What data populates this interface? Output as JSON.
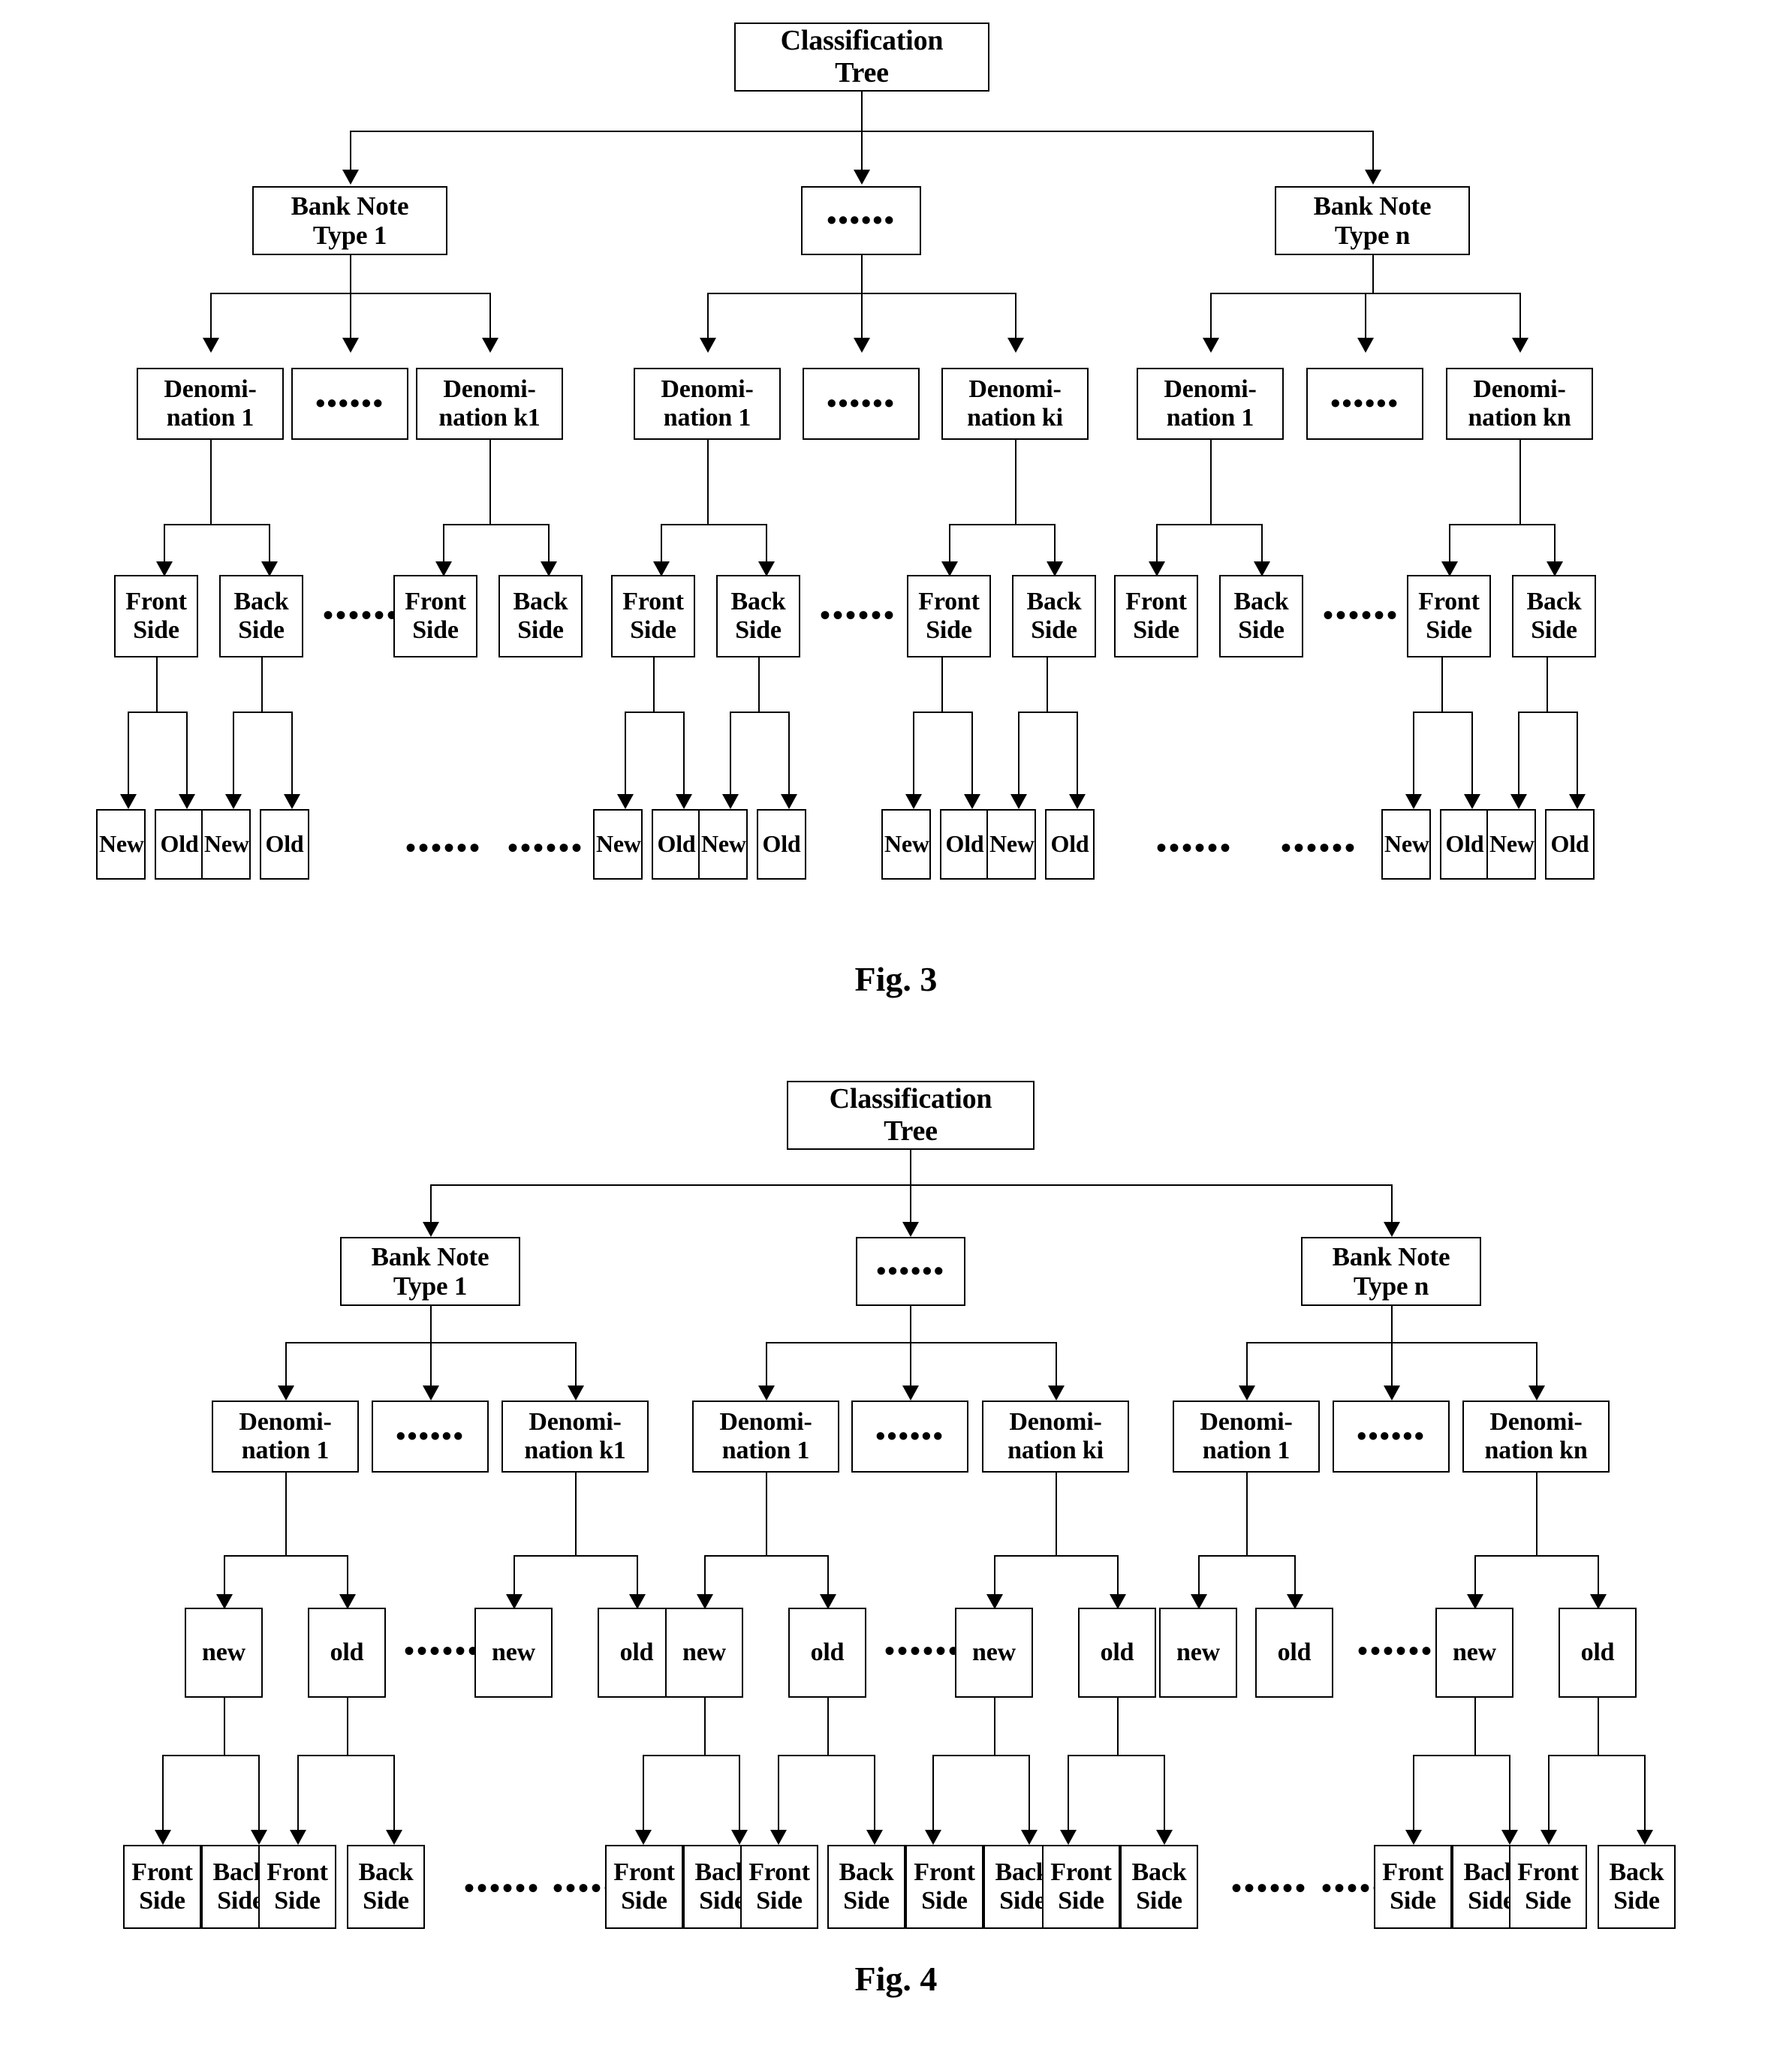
{
  "page": {
    "background": "#ffffff",
    "ink": "#000000"
  },
  "figures": [
    {
      "id": "fig3",
      "caption": "Fig. 3",
      "root": {
        "line1": "Classification",
        "line2": "Tree"
      },
      "level_types": [
        {
          "line1": "Bank Note",
          "line2": "Type 1"
        },
        {
          "dots": "••••••"
        },
        {
          "line1": "Bank Note",
          "line2": "Type n"
        }
      ],
      "level_denominations": [
        {
          "line1": "Denomi-",
          "line2": "nation 1"
        },
        {
          "dots": "••••••"
        },
        {
          "line1": "Denomi-",
          "line2": "nation k1"
        },
        {
          "line1": "Denomi-",
          "line2": "nation 1"
        },
        {
          "dots": "••••••"
        },
        {
          "line1": "Denomi-",
          "line2": "nation ki"
        },
        {
          "line1": "Denomi-",
          "line2": "nation 1"
        },
        {
          "dots": "••••••"
        },
        {
          "line1": "Denomi-",
          "line2": "nation kn"
        }
      ],
      "level_sides": [
        {
          "line1": "Front",
          "line2": "Side"
        },
        {
          "line1": "Back",
          "line2": "Side"
        },
        {
          "line1": "Front",
          "line2": "Side"
        },
        {
          "line1": "Back",
          "line2": "Side"
        },
        {
          "line1": "Front",
          "line2": "Side"
        },
        {
          "line1": "Back",
          "line2": "Side"
        },
        {
          "line1": "Front",
          "line2": "Side"
        },
        {
          "line1": "Back",
          "line2": "Side"
        },
        {
          "line1": "Front",
          "line2": "Side"
        },
        {
          "line1": "Back",
          "line2": "Side"
        },
        {
          "line1": "Front",
          "line2": "Side"
        },
        {
          "line1": "Back",
          "line2": "Side"
        }
      ],
      "level_sides_dots": [
        "••••••",
        "••••••",
        "••••••"
      ],
      "level_condition": [
        {
          "label": "New"
        },
        {
          "label": "Old"
        },
        {
          "label": "New"
        },
        {
          "label": "Old"
        },
        {
          "label": "New"
        },
        {
          "label": "Old"
        },
        {
          "label": "New"
        },
        {
          "label": "Old"
        },
        {
          "label": "New"
        },
        {
          "label": "Old"
        },
        {
          "label": "New"
        },
        {
          "label": "Old"
        },
        {
          "label": "New"
        },
        {
          "label": "Old"
        },
        {
          "label": "New"
        },
        {
          "label": "Old"
        }
      ],
      "level_condition_dots": [
        "••••••",
        "••••••",
        "••••••",
        "••••••"
      ]
    },
    {
      "id": "fig4",
      "caption": "Fig. 4",
      "root": {
        "line1": "Classification",
        "line2": "Tree"
      },
      "level_types": [
        {
          "line1": "Bank Note",
          "line2": "Type 1"
        },
        {
          "dots": "••••••"
        },
        {
          "line1": "Bank Note",
          "line2": "Type n"
        }
      ],
      "level_denominations": [
        {
          "line1": "Denomi-",
          "line2": "nation 1"
        },
        {
          "dots": "••••••"
        },
        {
          "line1": "Denomi-",
          "line2": "nation k1"
        },
        {
          "line1": "Denomi-",
          "line2": "nation 1"
        },
        {
          "dots": "••••••"
        },
        {
          "line1": "Denomi-",
          "line2": "nation ki"
        },
        {
          "line1": "Denomi-",
          "line2": "nation 1"
        },
        {
          "dots": "••••••"
        },
        {
          "line1": "Denomi-",
          "line2": "nation kn"
        }
      ],
      "level_condition": [
        {
          "label": "new"
        },
        {
          "label": "old"
        },
        {
          "label": "new"
        },
        {
          "label": "old"
        },
        {
          "label": "new"
        },
        {
          "label": "old"
        },
        {
          "label": "new"
        },
        {
          "label": "old"
        },
        {
          "label": "new"
        },
        {
          "label": "old"
        },
        {
          "label": "new"
        },
        {
          "label": "old"
        }
      ],
      "level_condition_dots": [
        "••••••",
        "••••••",
        "••••••"
      ],
      "level_sides": [
        {
          "line1": "Front",
          "line2": "Side"
        },
        {
          "line1": "Back",
          "line2": "Side"
        },
        {
          "line1": "Front",
          "line2": "Side"
        },
        {
          "line1": "Back",
          "line2": "Side"
        },
        {
          "line1": "Front",
          "line2": "Side"
        },
        {
          "line1": "Back",
          "line2": "Side"
        },
        {
          "line1": "Front",
          "line2": "Side"
        },
        {
          "line1": "Back",
          "line2": "Side"
        },
        {
          "line1": "Front",
          "line2": "Side"
        },
        {
          "line1": "Back",
          "line2": "Side"
        },
        {
          "line1": "Front",
          "line2": "Side"
        },
        {
          "line1": "Back",
          "line2": "Side"
        },
        {
          "line1": "Front",
          "line2": "Side"
        },
        {
          "line1": "Back",
          "line2": "Side"
        },
        {
          "line1": "Front",
          "line2": "Side"
        },
        {
          "line1": "Back",
          "line2": "Side"
        }
      ],
      "level_sides_dots": [
        "••••••",
        "••••••",
        "••••••",
        "••••••"
      ]
    }
  ]
}
